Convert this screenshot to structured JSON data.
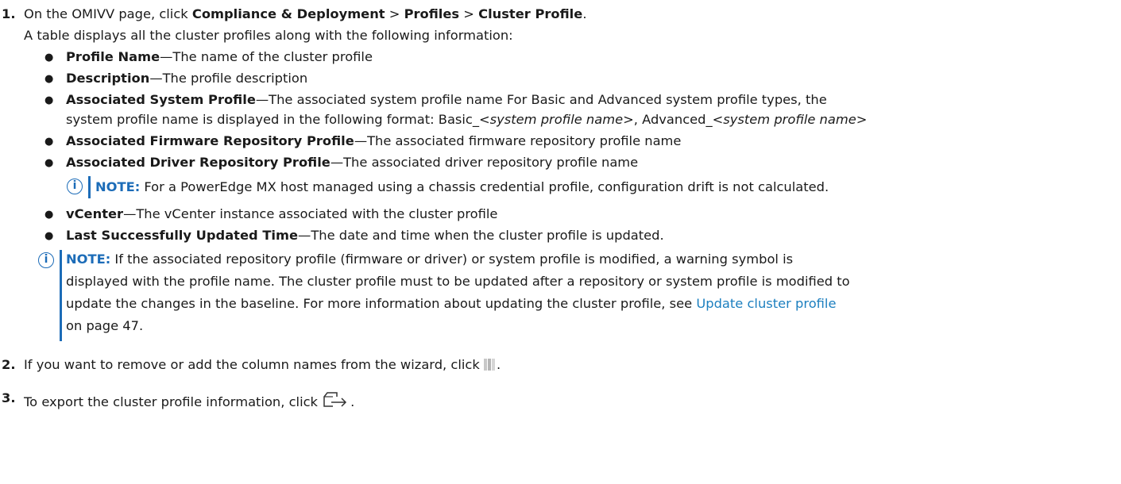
{
  "steps": [
    {
      "number": "1.",
      "pre": "On the OMIVV page, click ",
      "menu1": "Compliance & Deployment",
      "sep1": " > ",
      "menu2": "Profiles",
      "sep2": " > ",
      "menu3": "Cluster Profile",
      "post": ".",
      "intro": "A table displays all the cluster profiles along with the following information:"
    },
    {
      "number": "2.",
      "text": "If you want to remove or add the column names from the wizard, click ",
      "icon": "column-chooser-icon",
      "post": "."
    },
    {
      "number": "3.",
      "text": "To export the cluster profile information, click ",
      "icon": "export-icon",
      "post": "."
    }
  ],
  "bullets": [
    {
      "term": "Profile Name",
      "dash": "—",
      "desc": "The name of the cluster profile"
    },
    {
      "term": "Description",
      "dash": "—",
      "desc": "The profile description"
    },
    {
      "term": "Associated System Profile",
      "dash": "—",
      "desc": "The associated system profile name For Basic and Advanced system profile types, the",
      "line2_a": "system profile name is displayed in the following format: Basic_<",
      "line2_i1": "system profile name",
      "line2_b": ">, Advanced_<",
      "line2_i2": "system profile name",
      "line2_c": ">"
    },
    {
      "term": "Associated Firmware Repository Profile",
      "dash": "—",
      "desc": "The associated firmware repository profile name"
    },
    {
      "term": "Associated Driver Repository Profile",
      "dash": "—",
      "desc": "The associated driver repository profile name"
    },
    {
      "term": "vCenter",
      "dash": "—",
      "desc": "The vCenter instance associated with the cluster profile"
    },
    {
      "term": "Last Successfully Updated Time",
      "dash": "—",
      "desc": "The date and time when the cluster profile is updated."
    }
  ],
  "bullet_glyph": "●",
  "info_glyph": "i",
  "note1": {
    "label": "NOTE:",
    "text": " For a PowerEdge MX host managed using a chassis credential profile, configuration drift is not calculated."
  },
  "note2": {
    "label": "NOTE:",
    "line1": " If the associated repository profile (firmware or driver) or system profile is modified, a warning symbol is",
    "line2": "displayed with the profile name. The cluster profile must to be updated after a repository or system profile is modified to",
    "line3_pre": "update the changes in the baseline. For more information about updating the cluster profile, see ",
    "line3_link": "Update cluster profile",
    "line4": "on page 47."
  },
  "colors": {
    "accent": "#1c6cb8",
    "link": "#1c7fbf",
    "text": "#1a1a1a"
  }
}
